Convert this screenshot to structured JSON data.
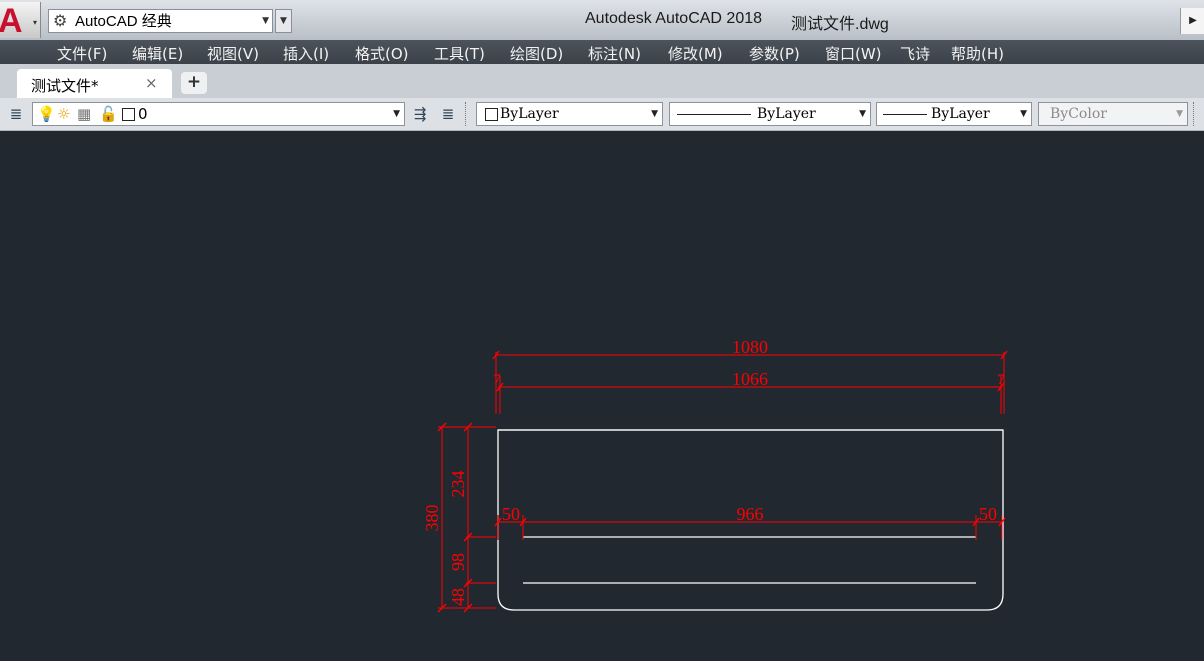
{
  "title_bar": {
    "workspace_label": "AutoCAD 经典",
    "app_title": "Autodesk AutoCAD 2018",
    "file_name": "测试文件.dwg",
    "app_logo": "A"
  },
  "menu": {
    "items": [
      "文件(F)",
      "编辑(E)",
      "视图(V)",
      "插入(I)",
      "格式(O)",
      "工具(T)",
      "绘图(D)",
      "标注(N)",
      "修改(M)",
      "参数(P)",
      "窗口(W)",
      "飞诗",
      "帮助(H)"
    ]
  },
  "tabs": {
    "active_label": "测试文件*",
    "close_glyph": "×",
    "add_glyph": "+"
  },
  "properties": {
    "layer_value": "0",
    "color_value": "ByLayer",
    "linetype_value": "ByLayer",
    "lineweight_value": "ByLayer",
    "plotstyle_value": "ByColor"
  },
  "icons": {
    "layer_manager": "layer-properties-icon",
    "bulb": "lightbulb-icon",
    "sun": "freeze-sun-icon",
    "lock": "unlock-icon",
    "make_current": "make-current-layer-icon",
    "layer_previous": "layer-previous-icon"
  },
  "drawing": {
    "dimension_color": "#ff0000",
    "geometry_color": "#ffffff",
    "dimensions": {
      "overall_width": "1080",
      "inner_width": "1066",
      "left_offset": "7",
      "right_offset": "7",
      "total_height": "380",
      "upper_height": "234",
      "middle_height": "98",
      "lower_height": "48",
      "left_margin": "50",
      "center_length": "966",
      "right_margin": "50"
    }
  }
}
